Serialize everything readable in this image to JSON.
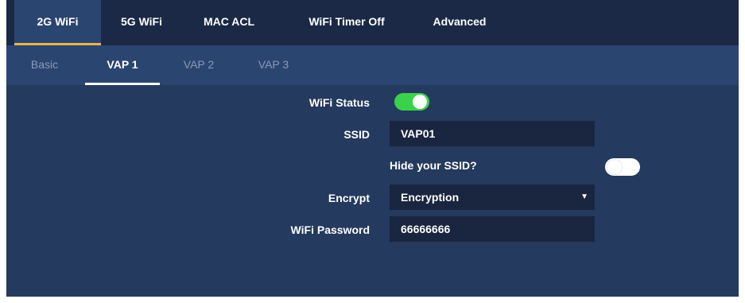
{
  "top_tabs": [
    {
      "label": "2G WiFi",
      "active": true
    },
    {
      "label": "5G WiFi",
      "active": false
    },
    {
      "label": "MAC ACL",
      "active": false
    },
    {
      "label": "WiFi Timer Off",
      "active": false
    },
    {
      "label": "Advanced",
      "active": false
    }
  ],
  "sub_tabs": [
    {
      "label": "Basic",
      "active": false
    },
    {
      "label": "VAP 1",
      "active": true
    },
    {
      "label": "VAP 2",
      "active": false
    },
    {
      "label": "VAP 3",
      "active": false
    }
  ],
  "form": {
    "wifi_status_label": "WiFi Status",
    "wifi_status_on": true,
    "ssid_label": "SSID",
    "ssid_value": "VAP01",
    "hide_ssid_label": "Hide your SSID?",
    "hide_ssid_on": false,
    "encrypt_label": "Encrypt",
    "encrypt_value": "Encryption",
    "password_label": "WiFi Password",
    "password_value": "66666666"
  },
  "colors": {
    "accent_underline": "#e9b44c",
    "toggle_on": "#3ad24a",
    "panel_bg": "#243a5e"
  }
}
